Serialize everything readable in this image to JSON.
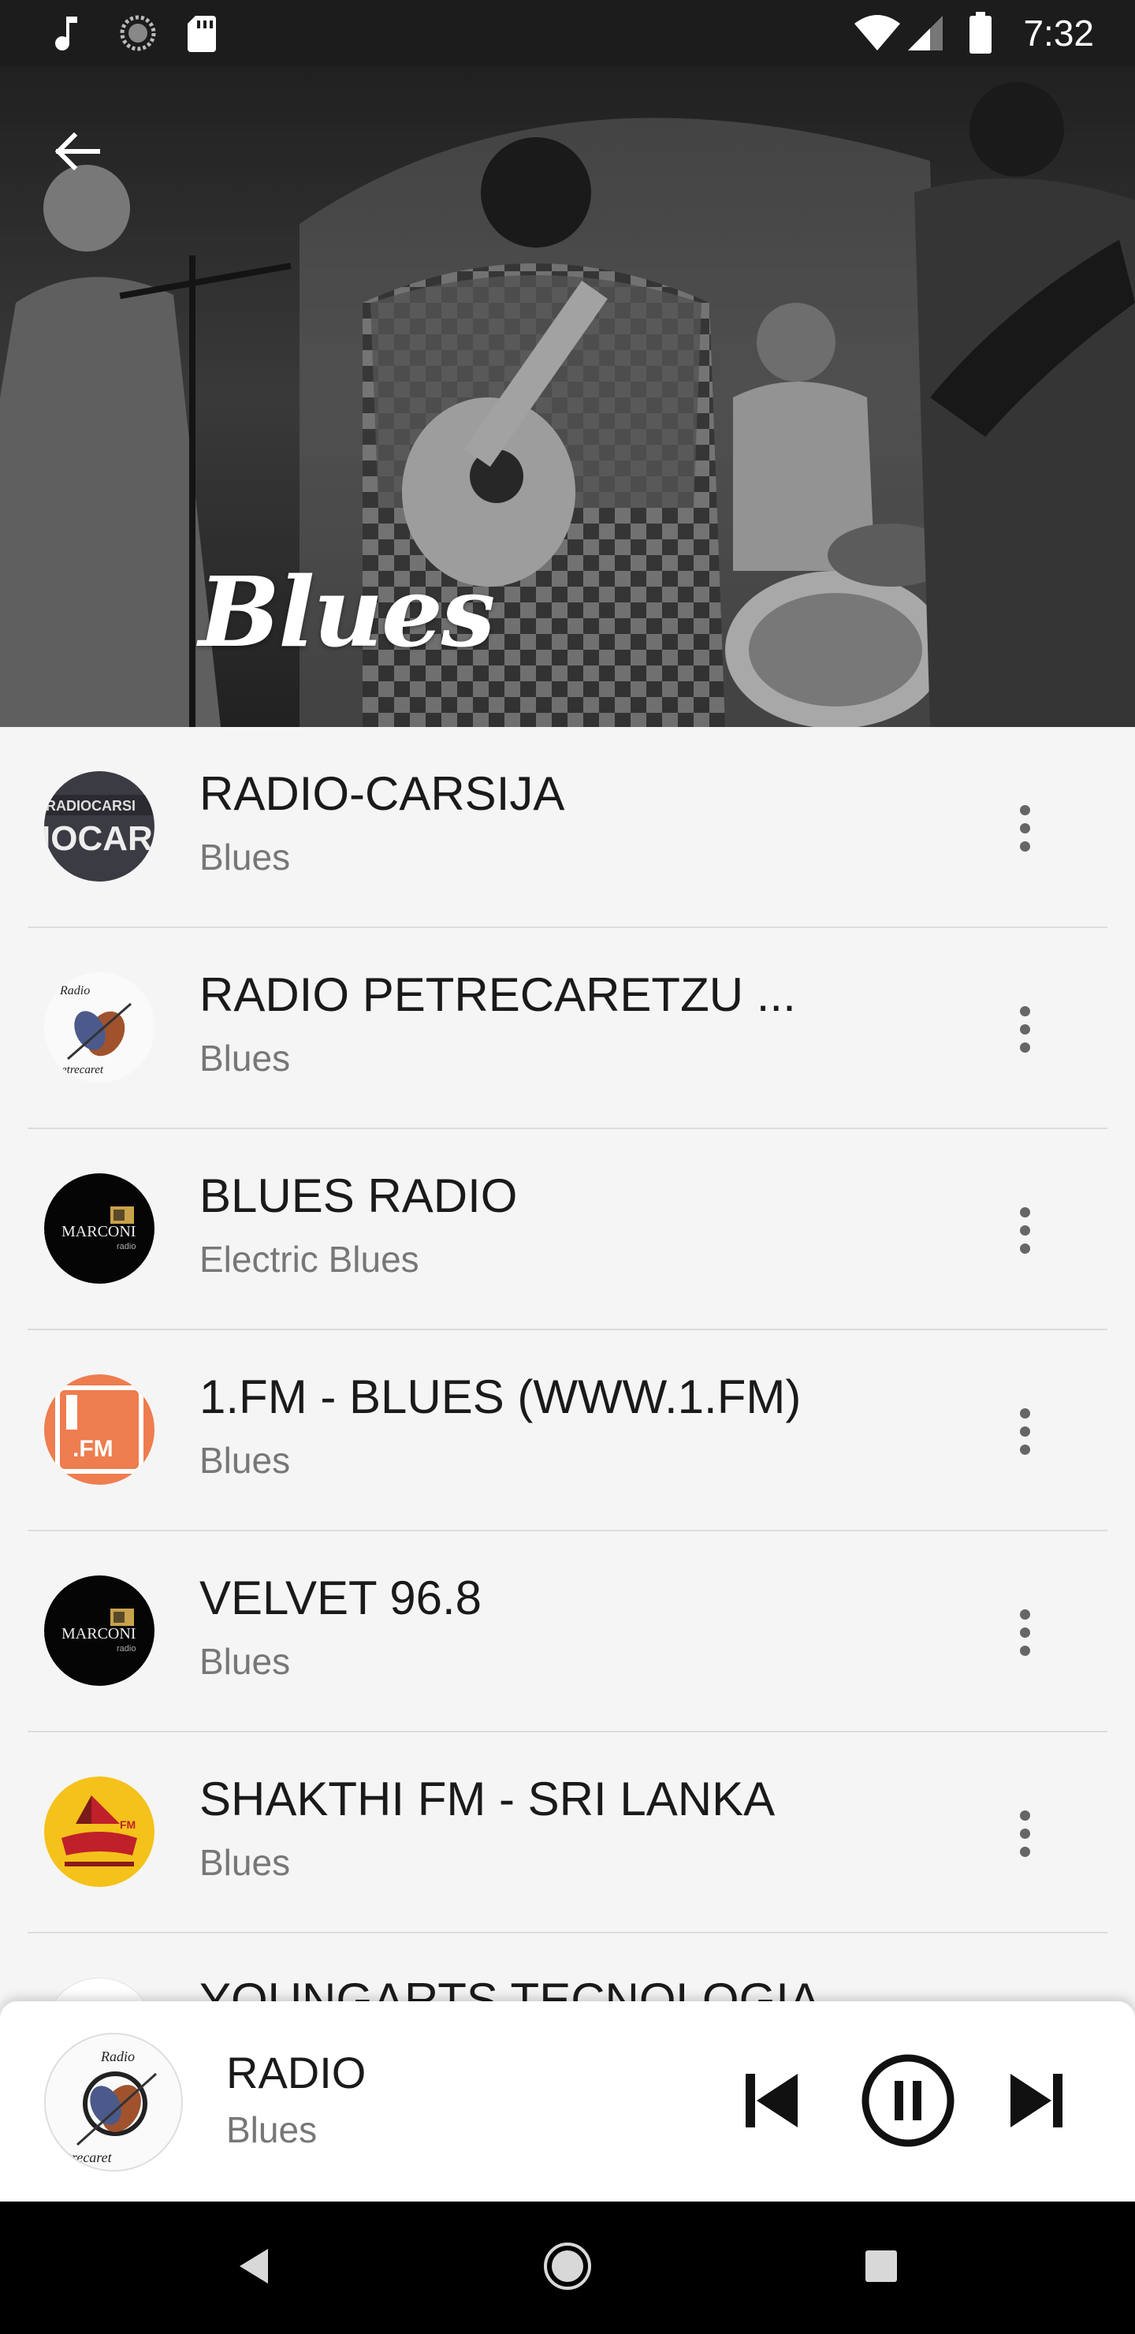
{
  "status_bar": {
    "time": "7:32",
    "icons": [
      "music-note-icon",
      "sync-icon",
      "sd-card-icon",
      "wifi-icon",
      "signal-icon",
      "battery-icon"
    ]
  },
  "header": {
    "title": "Blues",
    "back_icon": "arrow-left-icon"
  },
  "stations": [
    {
      "name": "RADIO-CARSIJA",
      "genre": "Blues",
      "logo": "radiocarsija-logo"
    },
    {
      "name": "RADIO PETRECARETZU ...",
      "genre": "Blues",
      "logo": "petrecaretzu-logo"
    },
    {
      "name": "BLUES RADIO",
      "genre": "Electric Blues",
      "logo": "marconi-logo"
    },
    {
      "name": "1.FM - BLUES (WWW.1.FM)",
      "genre": "Blues",
      "logo": "onefm-logo"
    },
    {
      "name": "VELVET 96.8",
      "genre": "Blues",
      "logo": "marconi-logo"
    },
    {
      "name": "SHAKTHI FM - SRI LANKA",
      "genre": "Blues",
      "logo": "shakthi-logo"
    },
    {
      "name": "YOUNGARTS TECNOLOGIA",
      "genre": "",
      "logo": "youngarts-logo"
    }
  ],
  "player": {
    "title": "RADIO",
    "genre": "Blues",
    "controls": [
      "skip-previous-icon",
      "pause-icon",
      "skip-next-icon"
    ]
  },
  "nav_bar": {
    "buttons": [
      "back-triangle-icon",
      "home-circle-icon",
      "recents-square-icon"
    ]
  },
  "colors": {
    "status_bar": "#1c1c1c",
    "list_background": "#f5f5f5",
    "primary_text": "#1a1a1a",
    "secondary_text": "#777777",
    "divider": "#dcdcdc",
    "onefm_orange": "#ee7d4f",
    "shakthi_yellow": "#f4c21a"
  }
}
